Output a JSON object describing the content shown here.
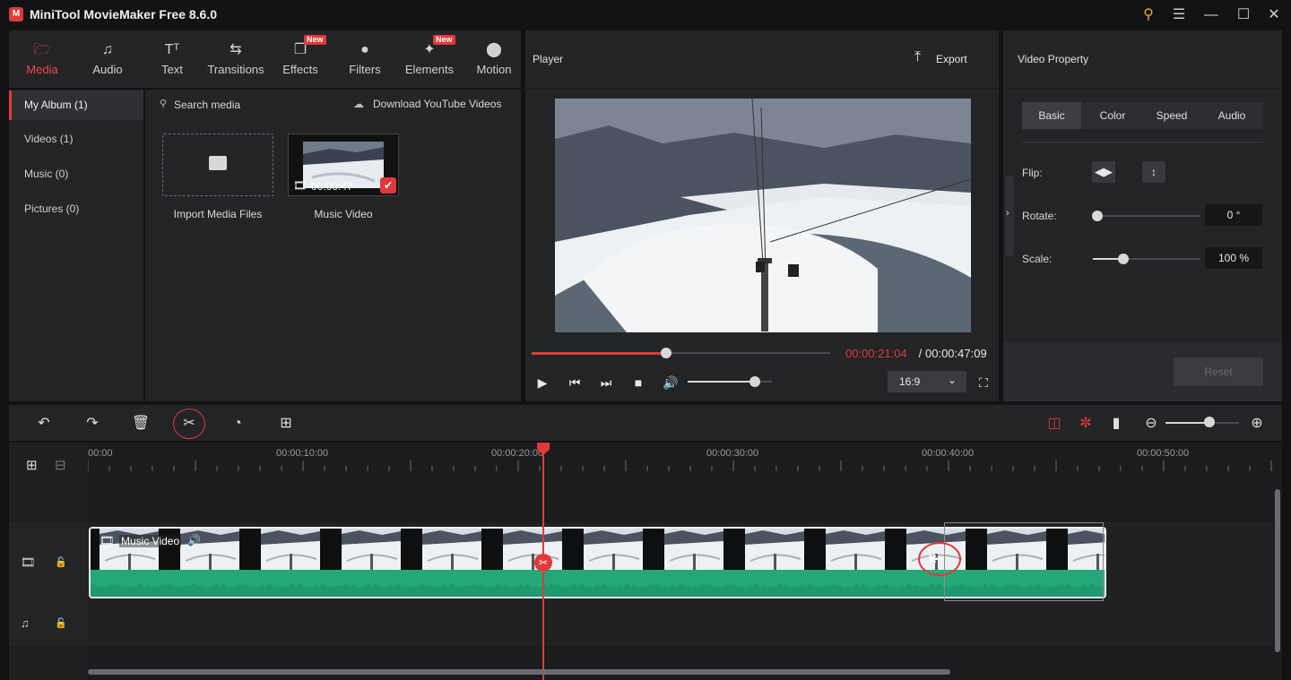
{
  "app": {
    "title": "MiniTool MovieMaker Free 8.6.0",
    "logo": "M"
  },
  "window_icons": [
    "key-icon",
    "menu-icon",
    "minimize-icon",
    "maximize-icon",
    "close-icon"
  ],
  "tabs": [
    {
      "label": "Media",
      "icon": "media-icon",
      "active": true
    },
    {
      "label": "Audio",
      "icon": "music-note-icon"
    },
    {
      "label": "Text",
      "icon": "text-icon"
    },
    {
      "label": "Transitions",
      "icon": "transitions-icon"
    },
    {
      "label": "Effects",
      "icon": "effects-icon",
      "badge": "New"
    },
    {
      "label": "Filters",
      "icon": "filters-icon"
    },
    {
      "label": "Elements",
      "icon": "elements-icon",
      "badge": "New"
    },
    {
      "label": "Motion",
      "icon": "motion-icon"
    }
  ],
  "album": [
    {
      "label": "My Album (1)",
      "active": true
    },
    {
      "label": "Videos (1)"
    },
    {
      "label": "Music (0)"
    },
    {
      "label": "Pictures (0)"
    }
  ],
  "media": {
    "search_placeholder": "Search media",
    "download_label": "Download YouTube Videos",
    "import_label": "Import Media Files",
    "item_label": "Music Video",
    "item_duration": "00:00:47"
  },
  "player": {
    "title": "Player",
    "export_label": "Export",
    "current_time": "00:00:21:04",
    "separator": " / ",
    "total_time": "00:00:47:09",
    "progress": 0.45,
    "volume": 0.8,
    "aspect": "16:9"
  },
  "property": {
    "title": "Video Property",
    "tabs": [
      "Basic",
      "Color",
      "Speed",
      "Audio"
    ],
    "flip_label": "Flip:",
    "rotate_label": "Rotate:",
    "rotate_value": "0 °",
    "rotate_level": 0.0,
    "scale_label": "Scale:",
    "scale_value": "100 %",
    "scale_level": 0.28,
    "reset_label": "Reset"
  },
  "timeline": {
    "ruler": [
      "00:00",
      "00:00:10:00",
      "00:00:20:00",
      "00:00:30:00",
      "00:00:40:00",
      "00:00:50:00"
    ],
    "clip_label": "Music Video",
    "zoom_level": 0.6
  },
  "colors": {
    "accent": "#e0393a",
    "waveform": "#2ab686",
    "panel": "#232426"
  }
}
